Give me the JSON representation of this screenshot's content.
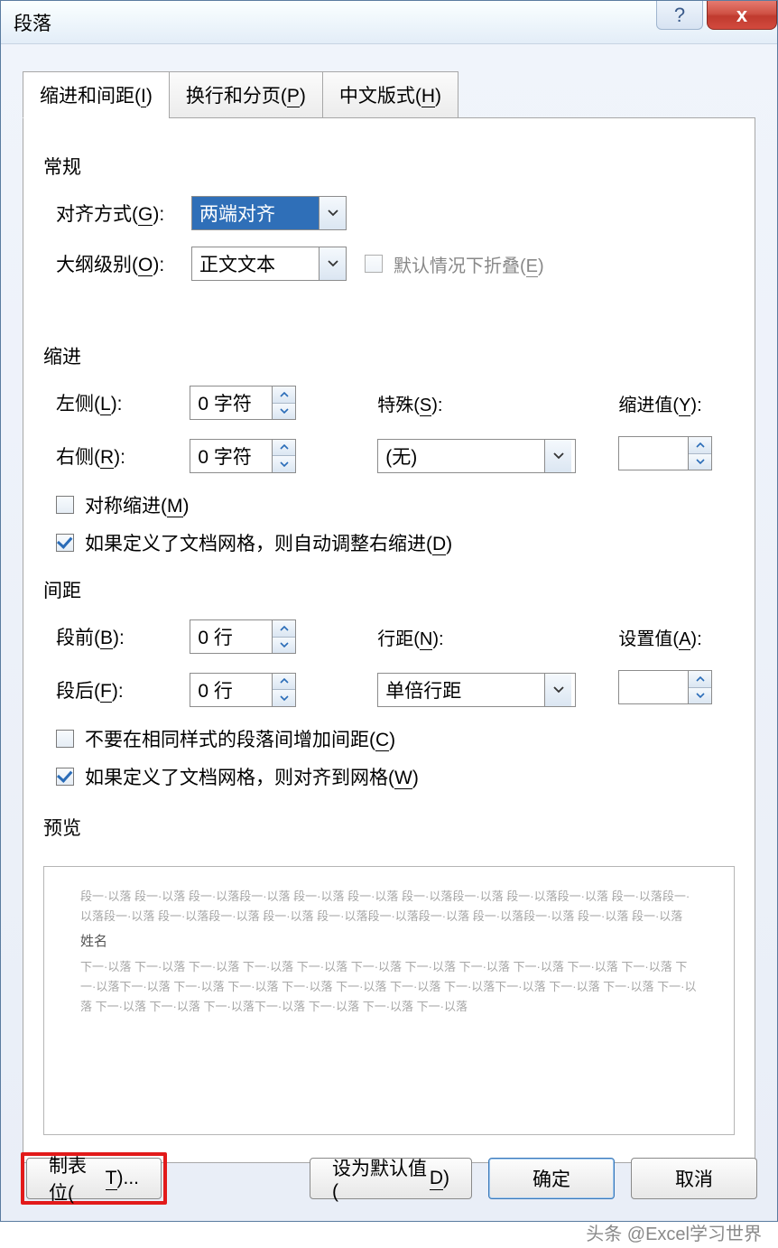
{
  "title": "段落",
  "tabs": {
    "indent": "缩进和间距(I)",
    "linebreak": "换行和分页(P)",
    "asian": "中文版式(H)"
  },
  "general": {
    "header": "常规",
    "alignment_label": "对齐方式(G):",
    "alignment_value": "两端对齐",
    "outline_label": "大纲级别(O):",
    "outline_value": "正文文本",
    "collapse_label": "默认情况下折叠(E)"
  },
  "indent": {
    "header": "缩进",
    "left_label": "左侧(L):",
    "left_value": "0 字符",
    "right_label": "右侧(R):",
    "right_value": "0 字符",
    "special_label": "特殊(S):",
    "special_value": "(无)",
    "by_label": "缩进值(Y):",
    "by_value": "",
    "mirror_label": "对称缩进(M)",
    "grid_label": "如果定义了文档网格，则自动调整右缩进(D)"
  },
  "spacing": {
    "header": "间距",
    "before_label": "段前(B):",
    "before_value": "0 行",
    "after_label": "段后(F):",
    "after_value": "0 行",
    "line_label": "行距(N):",
    "line_value": "单倍行距",
    "at_label": "设置值(A):",
    "at_value": "",
    "nosame_label": "不要在相同样式的段落间增加间距(C)",
    "grid_label": "如果定义了文档网格，则对齐到网格(W)"
  },
  "preview": {
    "header": "预览",
    "before_text": "段一·以落 段一·以落 段一·以落段一·以落 段一·以落 段一·以落 段一·以落段一·以落 段一·以落段一·以落 段一·以落段一·以落段一·以落 段一·以落段一·以落 段一·以落 段一·以落段一·以落段一·以落 段一·以落段一·以落 段一·以落 段一·以落",
    "body_text": "姓名",
    "after_text": "下一·以落 下一·以落 下一·以落 下一·以落 下一·以落 下一·以落 下一·以落 下一·以落 下一·以落 下一·以落 下一·以落 下一·以落下一·以落 下一·以落 下一·以落 下一·以落 下一·以落 下一·以落 下一·以落下一·以落 下一·以落 下一·以落 下一·以落 下一·以落 下一·以落 下一·以落下一·以落 下一·以落 下一·以落 下一·以落"
  },
  "buttons": {
    "tabs": "制表位(T)...",
    "default": "设为默认值(D)",
    "ok": "确定",
    "cancel": "取消"
  },
  "watermark": "头条 @Excel学习世界"
}
